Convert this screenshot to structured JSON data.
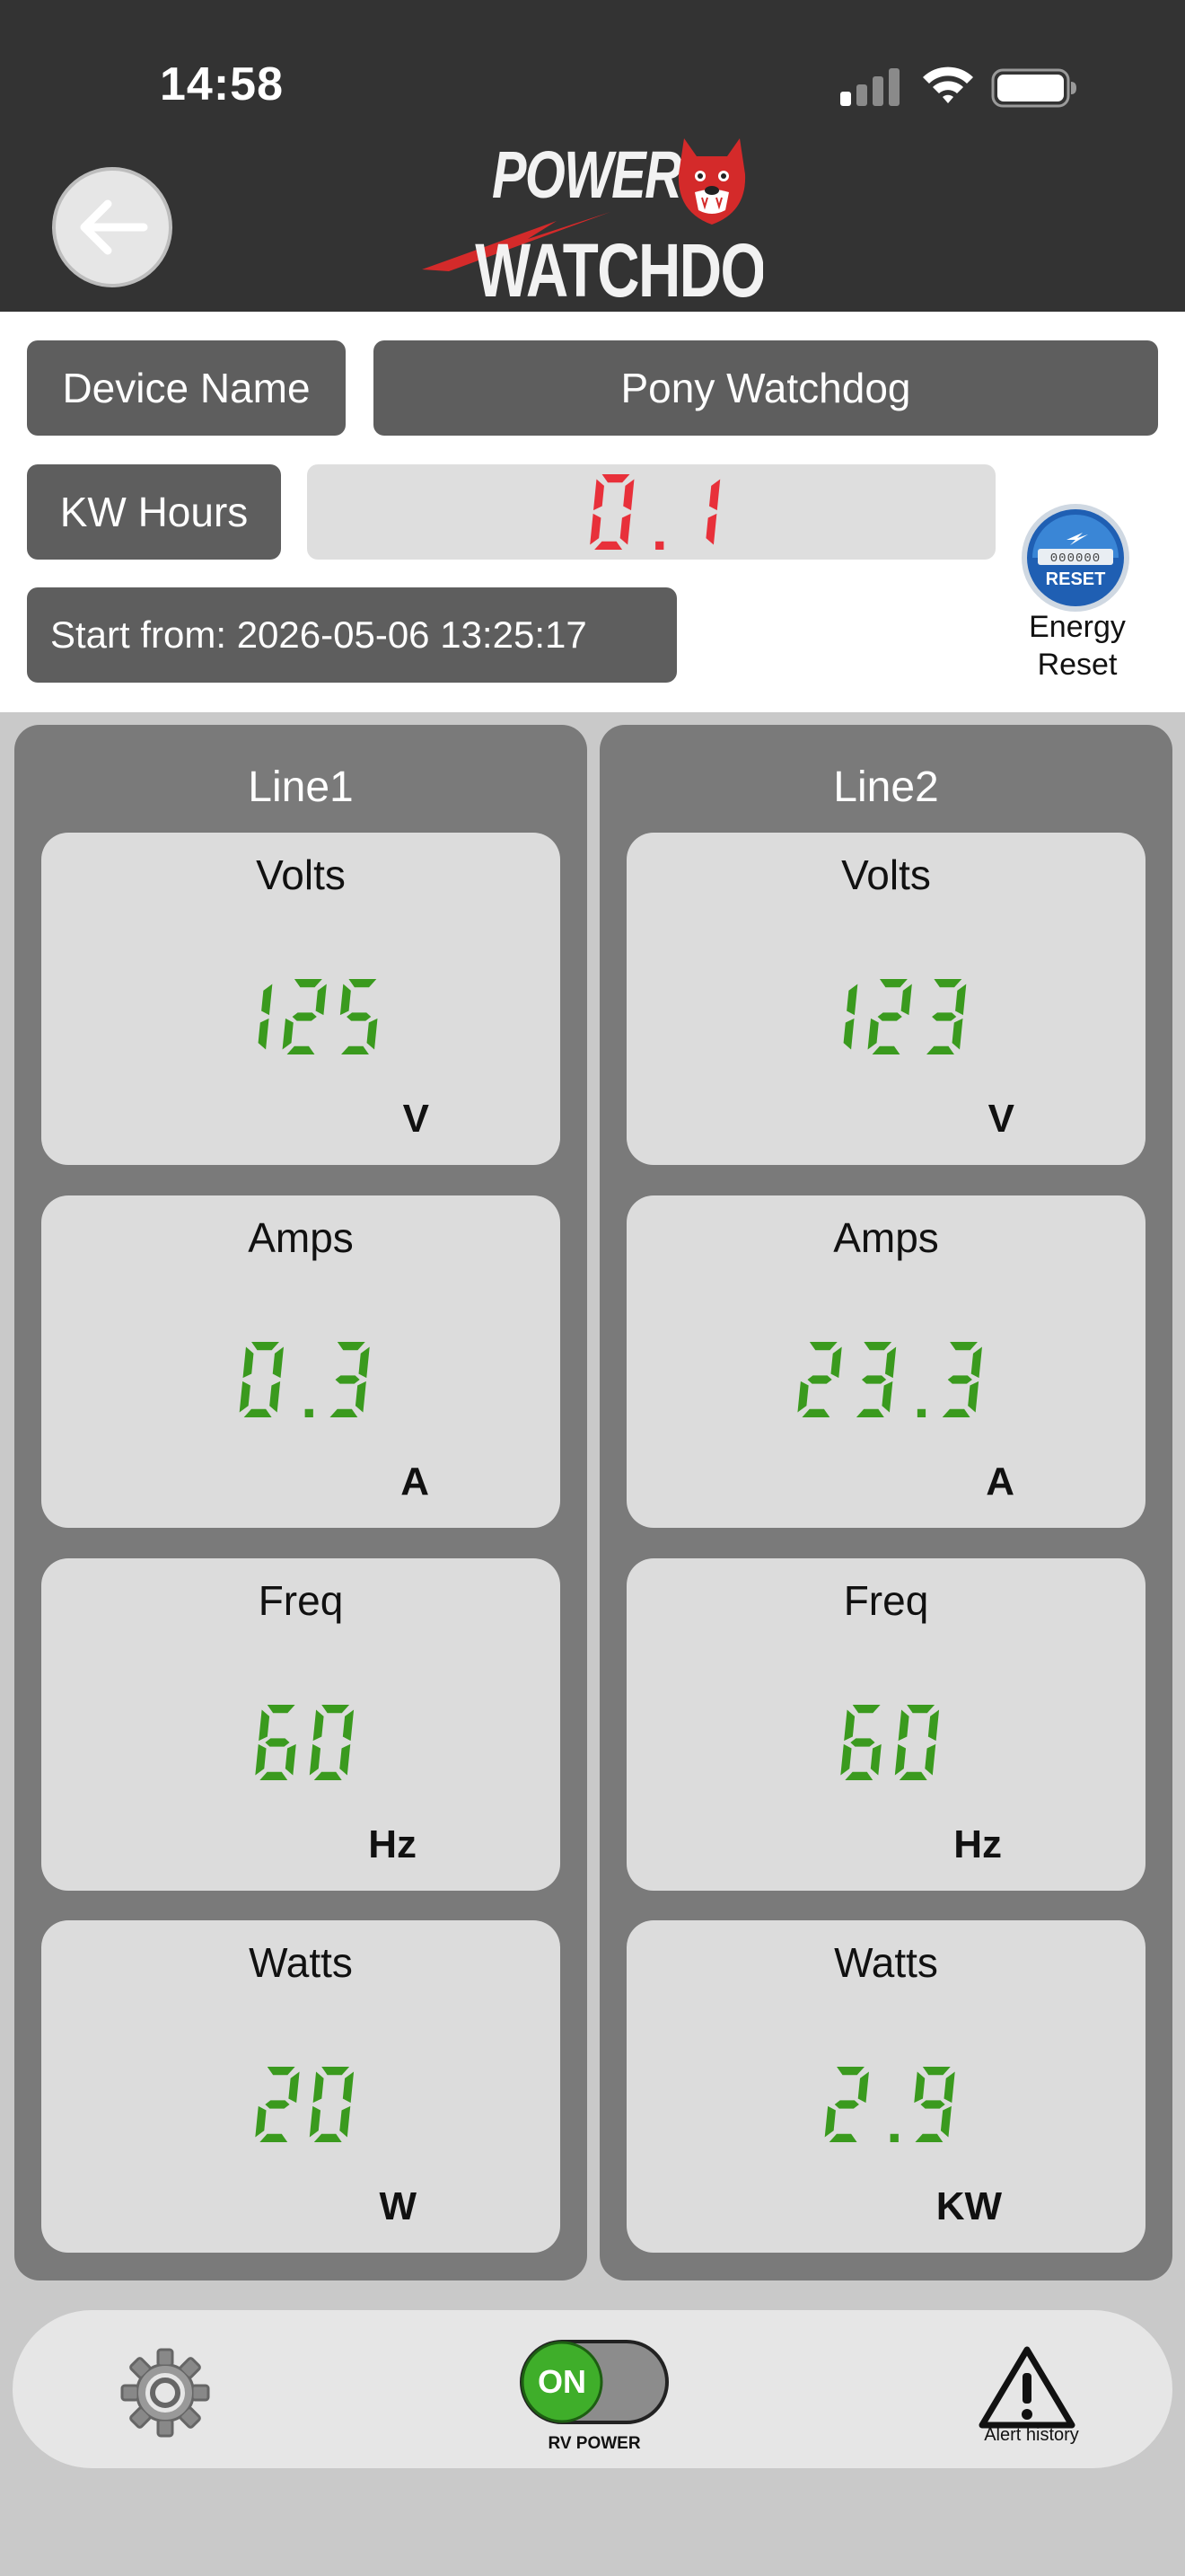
{
  "status_bar": {
    "time": "14:58"
  },
  "header": {
    "logo_line1": "POWER",
    "logo_line2": "WATCHDOG"
  },
  "device": {
    "name_label": "Device Name",
    "name_value": "Pony Watchdog",
    "kwh_label": "KW Hours",
    "kwh_value": "0.1",
    "start_from": "Start from: 2026-05-06 13:25:17",
    "energy_reset_label": "Energy\nReset",
    "reset_badge_text": "RESET",
    "reset_badge_digits": "000000"
  },
  "lines": [
    {
      "title": "Line1",
      "cards": [
        {
          "label": "Volts",
          "value": "125",
          "unit": "V"
        },
        {
          "label": "Amps",
          "value": "0.3",
          "unit": "A"
        },
        {
          "label": "Freq",
          "value": "60",
          "unit": "Hz"
        },
        {
          "label": "Watts",
          "value": "20",
          "unit": "W"
        }
      ]
    },
    {
      "title": "Line2",
      "cards": [
        {
          "label": "Volts",
          "value": "123",
          "unit": "V"
        },
        {
          "label": "Amps",
          "value": "23.3",
          "unit": "A"
        },
        {
          "label": "Freq",
          "value": "60",
          "unit": "Hz"
        },
        {
          "label": "Watts",
          "value": "2.9",
          "unit": "KW"
        }
      ]
    }
  ],
  "bottom_bar": {
    "power_toggle_state": "ON",
    "power_label": "RV POWER",
    "alert_label": "Alert history"
  },
  "colors": {
    "header_bg": "#333333",
    "digit_red": "#e8303a",
    "digit_green": "#3a9a1e",
    "toggle_green": "#3fae2a",
    "logo_red": "#d42a2a"
  }
}
